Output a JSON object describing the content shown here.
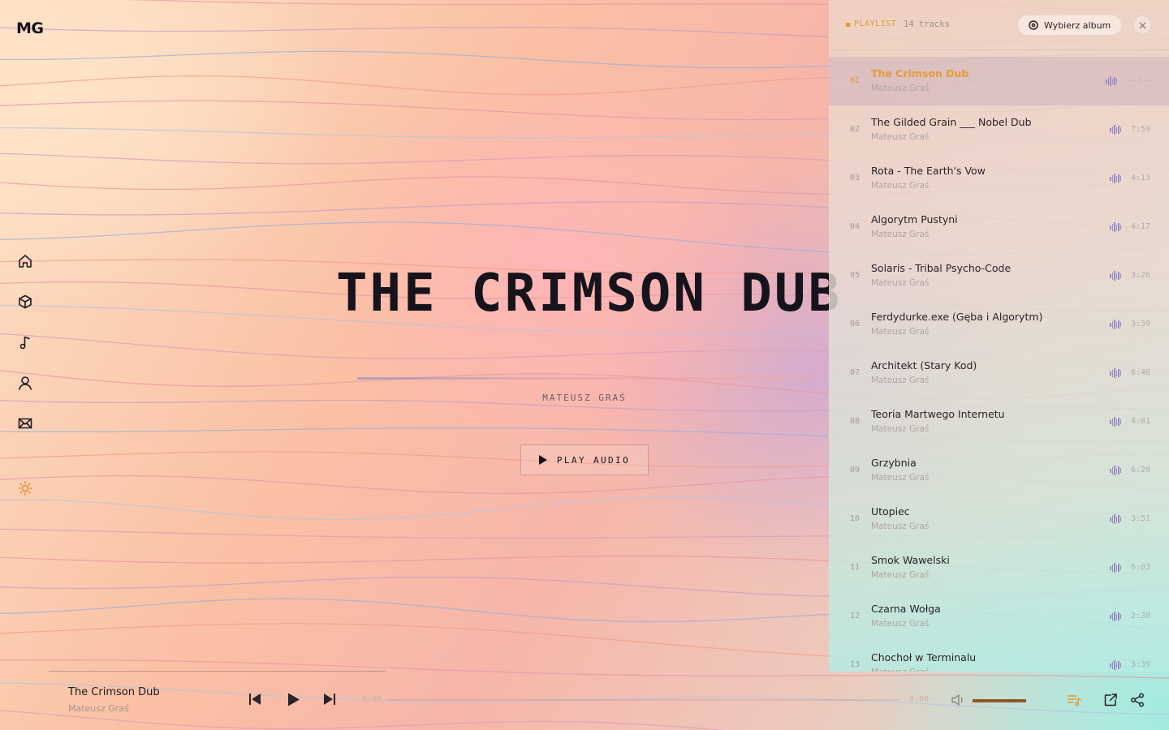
{
  "brand": {
    "logo": "MG"
  },
  "colors": {
    "accent": "#e39a3a",
    "text": "#1d1a24",
    "muted": "#b0a5a3",
    "wave": "#9b8ac8",
    "volume": "#8a5a2a"
  },
  "nav": {
    "items": [
      {
        "name": "home",
        "icon": "home-icon"
      },
      {
        "name": "projects",
        "icon": "cube-icon"
      },
      {
        "name": "music",
        "icon": "music-note-icon"
      },
      {
        "name": "about",
        "icon": "user-icon"
      },
      {
        "name": "contact",
        "icon": "mail-icon"
      },
      {
        "name": "theme",
        "icon": "sun-icon"
      }
    ]
  },
  "hero": {
    "title": "THE CRIMSON DUB",
    "artist": "MATEUSZ GRAŚ",
    "play_label": "PLAY AUDIO"
  },
  "playlist": {
    "label": "PLAYLIST",
    "count": "14 tracks",
    "album_button": "Wybierz album",
    "tracks": [
      {
        "num": "01",
        "title": "The Crimson Dub",
        "artist": "Mateusz Graś",
        "duration": "--:--",
        "active": true
      },
      {
        "num": "02",
        "title": "The Gilded Grain ___ Nobel Dub",
        "artist": "Mateusz Graś",
        "duration": "7:59"
      },
      {
        "num": "03",
        "title": "Rota - The Earth's Vow",
        "artist": "Mateusz Graś",
        "duration": "4:13"
      },
      {
        "num": "04",
        "title": "Algorytm Pustyni",
        "artist": "Mateusz Graś",
        "duration": "4:17"
      },
      {
        "num": "05",
        "title": "Solaris - Tribal Psycho-Code",
        "artist": "Mateusz Graś",
        "duration": "3:26"
      },
      {
        "num": "06",
        "title": "Ferdydurke.exe (Gęba i Algorytm)",
        "artist": "Mateusz Graś",
        "duration": "3:39"
      },
      {
        "num": "07",
        "title": "Architekt (Stary Kod)",
        "artist": "Mateusz Graś",
        "duration": "6:46"
      },
      {
        "num": "08",
        "title": "Teoria Martwego Internetu",
        "artist": "Mateusz Graś",
        "duration": "4:01"
      },
      {
        "num": "09",
        "title": "Grzybnia",
        "artist": "Mateusz Graś",
        "duration": "6:20"
      },
      {
        "num": "10",
        "title": "Utopiec",
        "artist": "Mateusz Graś",
        "duration": "3:51"
      },
      {
        "num": "11",
        "title": "Smok Wawelski",
        "artist": "Mateusz Graś",
        "duration": "6:03"
      },
      {
        "num": "12",
        "title": "Czarna Wołga",
        "artist": "Mateusz Graś",
        "duration": "2:38"
      },
      {
        "num": "13",
        "title": "Chochoł w Terminalu",
        "artist": "Mateusz Graś",
        "duration": "3:39"
      }
    ]
  },
  "player": {
    "title": "The Crimson Dub",
    "artist": "Mateusz Graś",
    "current_time": "0:00",
    "total_time": "0:00",
    "progress": 0,
    "volume": 1.0
  }
}
